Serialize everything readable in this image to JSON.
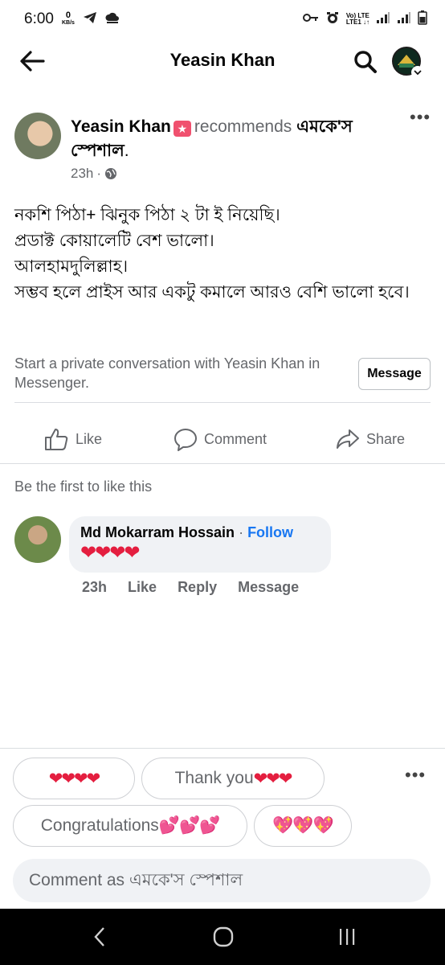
{
  "status_bar": {
    "time": "6:00",
    "net_speed_value": "0",
    "net_speed_unit": "KB/s",
    "network_top": "Vo) LTE",
    "network_bottom": "LTE1 ↓↑"
  },
  "nav": {
    "title": "Yeasin Khan",
    "icons": [
      "arrow-left-icon",
      "search-icon",
      "profile-avatar-chevron"
    ]
  },
  "post": {
    "author": "Yeasin Khan",
    "recommends": "recommends",
    "page": "এমকে'স স্পেশাল",
    "page_suffix": ".",
    "time": "23h",
    "meta_sep": "·",
    "body": [
      "নকশি পিঠা+ ঝিনুক পিঠা ২ টা ই নিয়েছি।",
      "প্রডাক্ট কোয়ালেটি বেশ ভালো।",
      "আলহামদুলিল্লাহ।",
      "সম্ভব হলে প্রাইস আর একটু কমালে আরও বেশি ভালো হবে।"
    ],
    "messenger_prompt": "Start a private conversation with Yeasin Khan in Messenger.",
    "message_button": "Message",
    "actions": {
      "like": "Like",
      "comment": "Comment",
      "share": "Share"
    },
    "first_like": "Be the first to like this"
  },
  "comment": {
    "name": "Md Mokarram Hossain",
    "sep": " · ",
    "follow": "Follow",
    "text": "❤❤❤❤",
    "time": "23h",
    "like": "Like",
    "reply": "Reply",
    "message": "Message"
  },
  "quick_replies": {
    "chip1": "❤❤❤❤",
    "chip2_text": "Thank you",
    "chip2_hearts": "❤❤❤",
    "chip3_text": "Congratulations ",
    "chip3_hearts": "💕💕💕",
    "chip4": "💖💖💖"
  },
  "comment_input": {
    "placeholder": "Comment as এমকে'স স্পেশাল"
  },
  "colors": {
    "link_blue": "#1877f2",
    "secondary_text": "#65676b",
    "heart_red": "#e41e3f",
    "bubble_bg": "#f0f2f5"
  }
}
